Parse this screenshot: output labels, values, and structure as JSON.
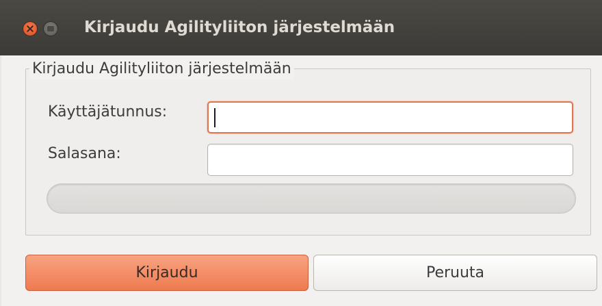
{
  "window": {
    "title": "Kirjaudu Agilityliiton järjestelmään"
  },
  "form": {
    "group_title": "Kirjaudu Agilityliiton järjestelmään",
    "username_label": "Käyttäjätunnus:",
    "username_value": "",
    "password_label": "Salasana:",
    "password_value": "",
    "progress": 0
  },
  "actions": {
    "login_label": "Kirjaudu",
    "cancel_label": "Peruuta"
  },
  "colors": {
    "accent": "#ee7a50",
    "titlebar": "#3c3b37",
    "window_bg": "#f2f1f0"
  },
  "icons": {
    "close": "close-icon",
    "minimize": "minimize-icon"
  }
}
